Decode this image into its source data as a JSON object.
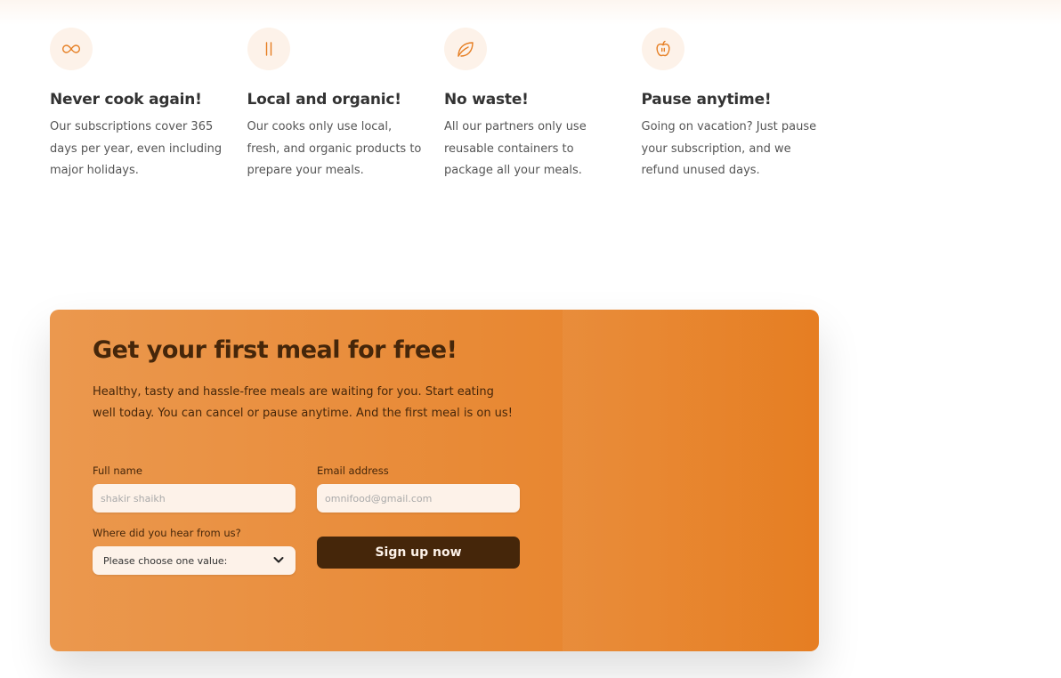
{
  "features": [
    {
      "icon": "infinity-icon",
      "title": "Never cook again!",
      "text": "Our subscriptions cover 365 days per year, even including major holidays."
    },
    {
      "icon": "pause-icon",
      "title": "Local and organic!",
      "text": "Our cooks only use local, fresh, and organic products to prepare your meals."
    },
    {
      "icon": "leaf-icon",
      "title": "No waste!",
      "text": "All our partners only use reusable containers to package all your meals."
    },
    {
      "icon": "apple-icon",
      "title": "Pause anytime!",
      "text": "Going on vacation? Just pause your subscription, and we refund unused days."
    }
  ],
  "cta": {
    "heading": "Get your first meal for free!",
    "description": "Healthy, tasty and hassle-free meals are waiting for you. Start eating well today. You can cancel or pause anytime. And the first meal is on us!",
    "form": {
      "full_name_label": "Full name",
      "full_name_placeholder": "shakir shaikh",
      "email_label": "Email address",
      "email_placeholder": "omnifood@gmail.com",
      "source_label": "Where did you hear from us?",
      "source_selected": "Please choose one value:",
      "submit_label": "Sign up now"
    }
  },
  "colors": {
    "accent": "#e67e22",
    "accent_light": "#eb984e",
    "tint": "#fdf2e9",
    "dark_brown": "#45260a"
  }
}
